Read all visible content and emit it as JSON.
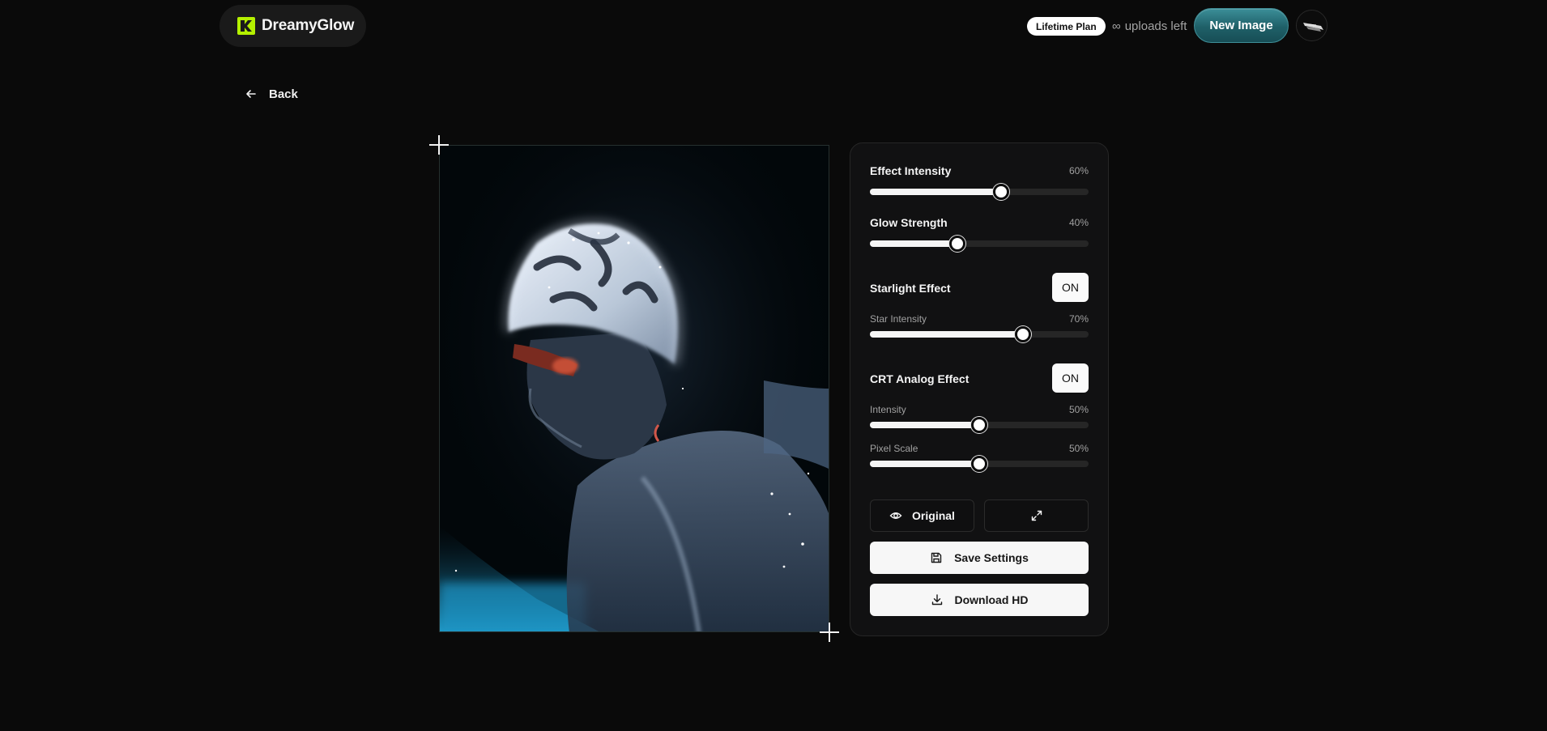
{
  "brand": {
    "name": "DreamyGlow",
    "accent": "#b4f000"
  },
  "header": {
    "plan_badge": "Lifetime Plan",
    "uploads_symbol": "∞",
    "uploads_text": "uploads left",
    "new_image_label": "New Image",
    "new_image_color": "#1f6068"
  },
  "nav": {
    "back_label": "Back"
  },
  "settings": {
    "effect_intensity": {
      "label": "Effect Intensity",
      "value_text": "60%",
      "value": 60
    },
    "glow_strength": {
      "label": "Glow Strength",
      "value_text": "40%",
      "value": 40
    },
    "starlight": {
      "label": "Starlight Effect",
      "toggle": "ON",
      "star_intensity": {
        "label": "Star Intensity",
        "value_text": "70%",
        "value": 70
      }
    },
    "crt": {
      "label": "CRT Analog Effect",
      "toggle": "ON",
      "intensity": {
        "label": "Intensity",
        "value_text": "50%",
        "value": 50
      },
      "pixel_scale": {
        "label": "Pixel Scale",
        "value_text": "50%",
        "value": 50
      }
    }
  },
  "actions": {
    "original_label": "Original",
    "original_icon": "eye-icon",
    "fullscreen_icon": "expand-icon",
    "save_label": "Save Settings",
    "save_icon": "save-icon",
    "download_label": "Download HD",
    "download_icon": "download-icon"
  }
}
